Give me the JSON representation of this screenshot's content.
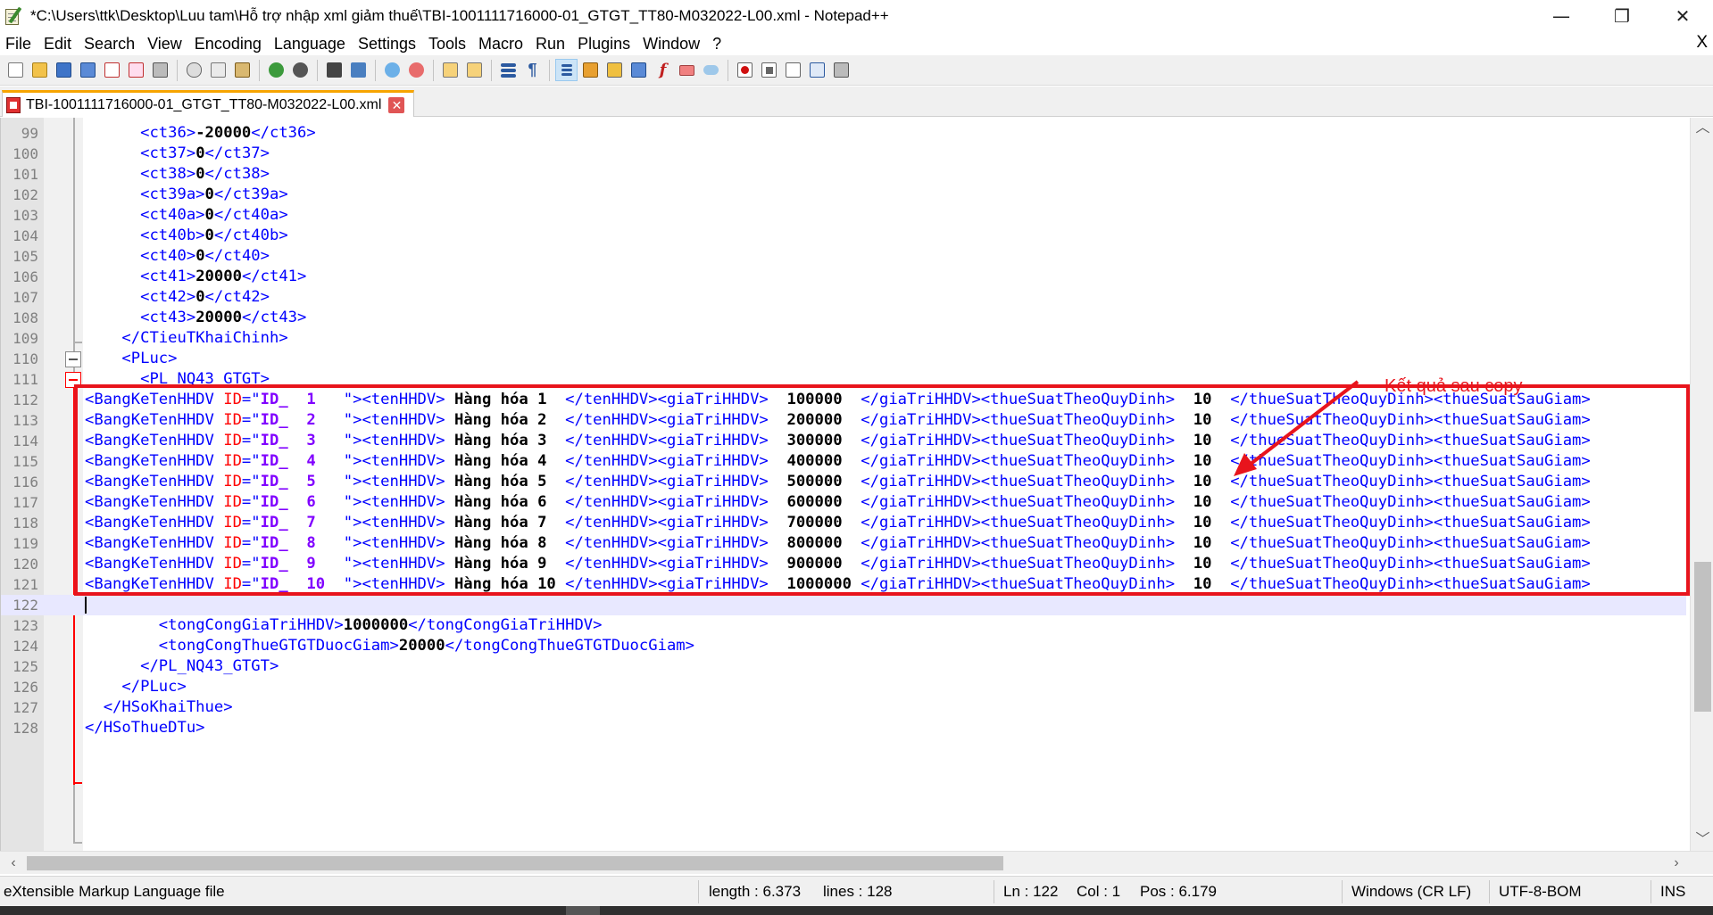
{
  "window": {
    "title": "*C:\\Users\\ttk\\Desktop\\Luu tam\\Hỗ trợ nhập xml giảm thuế\\TBI-1001111716000-01_GTGT_TT80-M032022-L00.xml - Notepad++",
    "minimize": "—",
    "restore": "❐",
    "close": "✕"
  },
  "menu": {
    "items": [
      "File",
      "Edit",
      "Search",
      "View",
      "Encoding",
      "Language",
      "Settings",
      "Tools",
      "Macro",
      "Run",
      "Plugins",
      "Window",
      "?"
    ],
    "close_doc": "X"
  },
  "toolbar": {
    "icons": [
      "new-file-icon",
      "open-file-icon",
      "save-icon",
      "save-all-icon",
      "close-icon",
      "close-all-icon",
      "print-icon",
      "cut-icon",
      "copy-icon",
      "paste-icon",
      "undo-icon",
      "redo-icon",
      "find-icon",
      "replace-icon",
      "zoom-in-icon",
      "zoom-out-icon",
      "sync-vertical-icon",
      "sync-horizontal-icon",
      "word-wrap-icon",
      "show-all-chars-icon",
      "indent-guide-icon",
      "user-language-icon",
      "doc-map-icon",
      "doc-list-icon",
      "function-list-icon",
      "folder-workspace-icon",
      "monitoring-icon",
      "record-macro-icon",
      "stop-record-icon",
      "play-macro-icon",
      "run-macro-multiple-icon",
      "save-macro-icon"
    ]
  },
  "tab": {
    "label": "TBI-1001111716000-01_GTGT_TT80-M032022-L00.xml",
    "close": "✕"
  },
  "editor": {
    "lines": [
      {
        "n": "99",
        "tokens": [
          [
            "i",
            "      "
          ],
          [
            "tag",
            "<ct36>"
          ],
          [
            "txt",
            "-20000"
          ],
          [
            "tag",
            "</ct36>"
          ]
        ]
      },
      {
        "n": "100",
        "tokens": [
          [
            "i",
            "      "
          ],
          [
            "tag",
            "<ct37>"
          ],
          [
            "txt",
            "0"
          ],
          [
            "tag",
            "</ct37>"
          ]
        ]
      },
      {
        "n": "101",
        "tokens": [
          [
            "i",
            "      "
          ],
          [
            "tag",
            "<ct38>"
          ],
          [
            "txt",
            "0"
          ],
          [
            "tag",
            "</ct38>"
          ]
        ]
      },
      {
        "n": "102",
        "tokens": [
          [
            "i",
            "      "
          ],
          [
            "tag",
            "<ct39a>"
          ],
          [
            "txt",
            "0"
          ],
          [
            "tag",
            "</ct39a>"
          ]
        ]
      },
      {
        "n": "103",
        "tokens": [
          [
            "i",
            "      "
          ],
          [
            "tag",
            "<ct40a>"
          ],
          [
            "txt",
            "0"
          ],
          [
            "tag",
            "</ct40a>"
          ]
        ]
      },
      {
        "n": "104",
        "tokens": [
          [
            "i",
            "      "
          ],
          [
            "tag",
            "<ct40b>"
          ],
          [
            "txt",
            "0"
          ],
          [
            "tag",
            "</ct40b>"
          ]
        ]
      },
      {
        "n": "105",
        "tokens": [
          [
            "i",
            "      "
          ],
          [
            "tag",
            "<ct40>"
          ],
          [
            "txt",
            "0"
          ],
          [
            "tag",
            "</ct40>"
          ]
        ]
      },
      {
        "n": "106",
        "tokens": [
          [
            "i",
            "      "
          ],
          [
            "tag",
            "<ct41>"
          ],
          [
            "txt",
            "20000"
          ],
          [
            "tag",
            "</ct41>"
          ]
        ]
      },
      {
        "n": "107",
        "tokens": [
          [
            "i",
            "      "
          ],
          [
            "tag",
            "<ct42>"
          ],
          [
            "txt",
            "0"
          ],
          [
            "tag",
            "</ct42>"
          ]
        ]
      },
      {
        "n": "108",
        "tokens": [
          [
            "i",
            "      "
          ],
          [
            "tag",
            "<ct43>"
          ],
          [
            "txt",
            "20000"
          ],
          [
            "tag",
            "</ct43>"
          ]
        ]
      },
      {
        "n": "109",
        "tokens": [
          [
            "i",
            "    "
          ],
          [
            "tag",
            "</CTieuTKhaiChinh>"
          ]
        ]
      },
      {
        "n": "110",
        "tokens": [
          [
            "i",
            "    "
          ],
          [
            "tag",
            "<PLuc>"
          ]
        ]
      },
      {
        "n": "111",
        "tokens": [
          [
            "i",
            "      "
          ],
          [
            "tag",
            "<PL_NQ43_GTGT>"
          ]
        ]
      },
      {
        "n": "112",
        "tokens": [
          [
            "tag",
            "<BangKeTenHHDV "
          ],
          [
            "attr",
            "ID"
          ],
          [
            "tag",
            "=\""
          ],
          [
            "val",
            "ID_  1"
          ],
          [
            "tag",
            "   \"><tenHHDV>"
          ],
          [
            "txt",
            " Hàng hóa 1 "
          ],
          [
            "tag",
            " </tenHHDV><giaTriHHDV>"
          ],
          [
            "txt",
            "  100000 "
          ],
          [
            "tag",
            " </giaTriHHDV><thueSuatTheoQuyDinh>"
          ],
          [
            "txt",
            "  10 "
          ],
          [
            "tag",
            " </thueSuatTheoQuyDinh><thueSuatSauGiam>"
          ]
        ]
      },
      {
        "n": "113",
        "tokens": [
          [
            "tag",
            "<BangKeTenHHDV "
          ],
          [
            "attr",
            "ID"
          ],
          [
            "tag",
            "=\""
          ],
          [
            "val",
            "ID_  2"
          ],
          [
            "tag",
            "   \"><tenHHDV>"
          ],
          [
            "txt",
            " Hàng hóa 2 "
          ],
          [
            "tag",
            " </tenHHDV><giaTriHHDV>"
          ],
          [
            "txt",
            "  200000 "
          ],
          [
            "tag",
            " </giaTriHHDV><thueSuatTheoQuyDinh>"
          ],
          [
            "txt",
            "  10 "
          ],
          [
            "tag",
            " </thueSuatTheoQuyDinh><thueSuatSauGiam>"
          ]
        ]
      },
      {
        "n": "114",
        "tokens": [
          [
            "tag",
            "<BangKeTenHHDV "
          ],
          [
            "attr",
            "ID"
          ],
          [
            "tag",
            "=\""
          ],
          [
            "val",
            "ID_  3"
          ],
          [
            "tag",
            "   \"><tenHHDV>"
          ],
          [
            "txt",
            " Hàng hóa 3 "
          ],
          [
            "tag",
            " </tenHHDV><giaTriHHDV>"
          ],
          [
            "txt",
            "  300000 "
          ],
          [
            "tag",
            " </giaTriHHDV><thueSuatTheoQuyDinh>"
          ],
          [
            "txt",
            "  10 "
          ],
          [
            "tag",
            " </thueSuatTheoQuyDinh><thueSuatSauGiam>"
          ]
        ]
      },
      {
        "n": "115",
        "tokens": [
          [
            "tag",
            "<BangKeTenHHDV "
          ],
          [
            "attr",
            "ID"
          ],
          [
            "tag",
            "=\""
          ],
          [
            "val",
            "ID_  4"
          ],
          [
            "tag",
            "   \"><tenHHDV>"
          ],
          [
            "txt",
            " Hàng hóa 4 "
          ],
          [
            "tag",
            " </tenHHDV><giaTriHHDV>"
          ],
          [
            "txt",
            "  400000 "
          ],
          [
            "tag",
            " </giaTriHHDV><thueSuatTheoQuyDinh>"
          ],
          [
            "txt",
            "  10 "
          ],
          [
            "tag",
            " </thueSuatTheoQuyDinh><thueSuatSauGiam>"
          ]
        ]
      },
      {
        "n": "116",
        "tokens": [
          [
            "tag",
            "<BangKeTenHHDV "
          ],
          [
            "attr",
            "ID"
          ],
          [
            "tag",
            "=\""
          ],
          [
            "val",
            "ID_  5"
          ],
          [
            "tag",
            "   \"><tenHHDV>"
          ],
          [
            "txt",
            " Hàng hóa 5 "
          ],
          [
            "tag",
            " </tenHHDV><giaTriHHDV>"
          ],
          [
            "txt",
            "  500000 "
          ],
          [
            "tag",
            " </giaTriHHDV><thueSuatTheoQuyDinh>"
          ],
          [
            "txt",
            "  10 "
          ],
          [
            "tag",
            " </thueSuatTheoQuyDinh><thueSuatSauGiam>"
          ]
        ]
      },
      {
        "n": "117",
        "tokens": [
          [
            "tag",
            "<BangKeTenHHDV "
          ],
          [
            "attr",
            "ID"
          ],
          [
            "tag",
            "=\""
          ],
          [
            "val",
            "ID_  6"
          ],
          [
            "tag",
            "   \"><tenHHDV>"
          ],
          [
            "txt",
            " Hàng hóa 6 "
          ],
          [
            "tag",
            " </tenHHDV><giaTriHHDV>"
          ],
          [
            "txt",
            "  600000 "
          ],
          [
            "tag",
            " </giaTriHHDV><thueSuatTheoQuyDinh>"
          ],
          [
            "txt",
            "  10 "
          ],
          [
            "tag",
            " </thueSuatTheoQuyDinh><thueSuatSauGiam>"
          ]
        ]
      },
      {
        "n": "118",
        "tokens": [
          [
            "tag",
            "<BangKeTenHHDV "
          ],
          [
            "attr",
            "ID"
          ],
          [
            "tag",
            "=\""
          ],
          [
            "val",
            "ID_  7"
          ],
          [
            "tag",
            "   \"><tenHHDV>"
          ],
          [
            "txt",
            " Hàng hóa 7 "
          ],
          [
            "tag",
            " </tenHHDV><giaTriHHDV>"
          ],
          [
            "txt",
            "  700000 "
          ],
          [
            "tag",
            " </giaTriHHDV><thueSuatTheoQuyDinh>"
          ],
          [
            "txt",
            "  10 "
          ],
          [
            "tag",
            " </thueSuatTheoQuyDinh><thueSuatSauGiam>"
          ]
        ]
      },
      {
        "n": "119",
        "tokens": [
          [
            "tag",
            "<BangKeTenHHDV "
          ],
          [
            "attr",
            "ID"
          ],
          [
            "tag",
            "=\""
          ],
          [
            "val",
            "ID_  8"
          ],
          [
            "tag",
            "   \"><tenHHDV>"
          ],
          [
            "txt",
            " Hàng hóa 8 "
          ],
          [
            "tag",
            " </tenHHDV><giaTriHHDV>"
          ],
          [
            "txt",
            "  800000 "
          ],
          [
            "tag",
            " </giaTriHHDV><thueSuatTheoQuyDinh>"
          ],
          [
            "txt",
            "  10 "
          ],
          [
            "tag",
            " </thueSuatTheoQuyDinh><thueSuatSauGiam>"
          ]
        ]
      },
      {
        "n": "120",
        "tokens": [
          [
            "tag",
            "<BangKeTenHHDV "
          ],
          [
            "attr",
            "ID"
          ],
          [
            "tag",
            "=\""
          ],
          [
            "val",
            "ID_  9"
          ],
          [
            "tag",
            "   \"><tenHHDV>"
          ],
          [
            "txt",
            " Hàng hóa 9 "
          ],
          [
            "tag",
            " </tenHHDV><giaTriHHDV>"
          ],
          [
            "txt",
            "  900000 "
          ],
          [
            "tag",
            " </giaTriHHDV><thueSuatTheoQuyDinh>"
          ],
          [
            "txt",
            "  10 "
          ],
          [
            "tag",
            " </thueSuatTheoQuyDinh><thueSuatSauGiam>"
          ]
        ]
      },
      {
        "n": "121",
        "tokens": [
          [
            "tag",
            "<BangKeTenHHDV "
          ],
          [
            "attr",
            "ID"
          ],
          [
            "tag",
            "=\""
          ],
          [
            "val",
            "ID_  10"
          ],
          [
            "tag",
            "  \"><tenHHDV>"
          ],
          [
            "txt",
            " Hàng hóa 10"
          ],
          [
            "tag",
            " </tenHHDV><giaTriHHDV>"
          ],
          [
            "txt",
            "  1000000"
          ],
          [
            "tag",
            " </giaTriHHDV><thueSuatTheoQuyDinh>"
          ],
          [
            "txt",
            "  10 "
          ],
          [
            "tag",
            " </thueSuatTheoQuyDinh><thueSuatSauGiam>"
          ]
        ]
      },
      {
        "n": "122",
        "tokens": []
      },
      {
        "n": "123",
        "tokens": [
          [
            "i",
            "        "
          ],
          [
            "tag",
            "<tongCongGiaTriHHDV>"
          ],
          [
            "txt",
            "1000000"
          ],
          [
            "tag",
            "</tongCongGiaTriHHDV>"
          ]
        ]
      },
      {
        "n": "124",
        "tokens": [
          [
            "i",
            "        "
          ],
          [
            "tag",
            "<tongCongThueGTGTDuocGiam>"
          ],
          [
            "txt",
            "20000"
          ],
          [
            "tag",
            "</tongCongThueGTGTDuocGiam>"
          ]
        ]
      },
      {
        "n": "125",
        "tokens": [
          [
            "i",
            "      "
          ],
          [
            "tag",
            "</PL_NQ43_GTGT>"
          ]
        ]
      },
      {
        "n": "126",
        "tokens": [
          [
            "i",
            "    "
          ],
          [
            "tag",
            "</PLuc>"
          ]
        ]
      },
      {
        "n": "127",
        "tokens": [
          [
            "i",
            "  "
          ],
          [
            "tag",
            "</HSoKhaiThue>"
          ]
        ]
      },
      {
        "n": "128",
        "tokens": [
          [
            "tag",
            "</HSoThueDTu>"
          ]
        ]
      }
    ],
    "current_line": "122"
  },
  "annotation": {
    "text": "Kết quả sau copy",
    "color": "#e8141c"
  },
  "status": {
    "file_type": "eXtensible Markup Language file",
    "length": "length : 6.373",
    "lines": "lines : 128",
    "ln": "Ln : 122",
    "col": "Col : 1",
    "pos": "Pos : 6.179",
    "eol": "Windows (CR LF)",
    "encoding": "UTF-8-BOM",
    "mode": "INS"
  }
}
